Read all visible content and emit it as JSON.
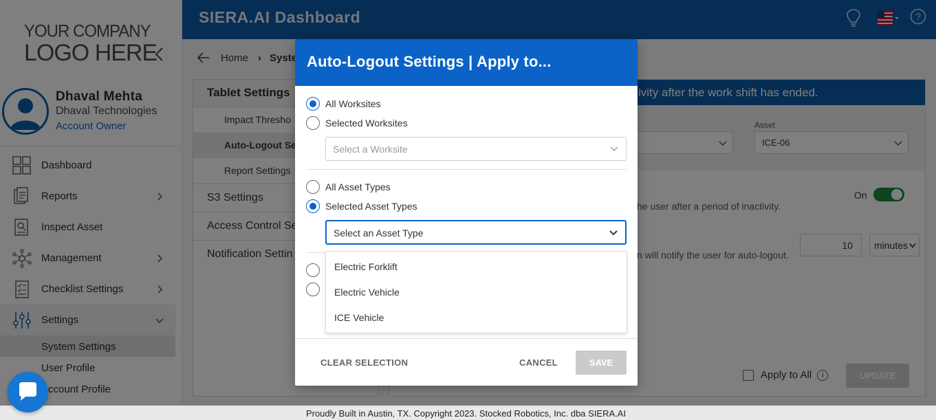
{
  "logo": {
    "line1": "YOUR COMPANY",
    "line2": "LOGO HERE"
  },
  "profile": {
    "name": "Dhaval Mehta",
    "company": "Dhaval Technologies",
    "role": "Account Owner"
  },
  "nav": {
    "items": [
      {
        "label": "Dashboard",
        "icon": "dashboard-grid-icon"
      },
      {
        "label": "Reports",
        "icon": "reports-icon"
      },
      {
        "label": "Inspect Asset",
        "icon": "inspect-asset-icon"
      },
      {
        "label": "Management",
        "icon": "management-network-icon"
      },
      {
        "label": "Checklist Settings",
        "icon": "checklist-icon"
      },
      {
        "label": "Settings",
        "icon": "settings-sliders-icon"
      }
    ],
    "settings_sub": [
      "System Settings",
      "User Profile",
      "Account Profile"
    ]
  },
  "topbar": {
    "brand": "SIERA.AI Dashboard"
  },
  "breadcrumb": {
    "home": "Home",
    "current": "Syste"
  },
  "settings_panel": {
    "header": "Tablet Settings",
    "subs": [
      "Impact Thresho",
      "Auto-Logout Se",
      "Report Settings"
    ],
    "sections": [
      "S3 Settings",
      "Access Control Se",
      "Notification Settin"
    ]
  },
  "content": {
    "banner": "ivity after the work shift has ended.",
    "asset_label": "Asset",
    "asset_value": "ICE-06",
    "toggle_label": "On",
    "desc1": "he user after a period of inactivity.",
    "desc2": "n will notify the user for auto-logout.",
    "minutes_value": "10",
    "unit": "minutes",
    "apply_all": "Apply to All",
    "info": "i",
    "update": "UPDATE"
  },
  "modal": {
    "title": "Auto-Logout Settings | Apply to...",
    "worksite_options": [
      "All Worksites",
      "Selected Worksites"
    ],
    "worksite_placeholder": "Select a Worksite",
    "asset_type_options": [
      "All Asset Types",
      "Selected Asset Types"
    ],
    "asset_type_placeholder": "Select an Asset Type",
    "dropdown_options": [
      "Electric Forklift",
      "Electric Vehicle",
      "ICE Vehicle"
    ],
    "clear": "CLEAR SELECTION",
    "cancel": "CANCEL",
    "save": "SAVE"
  },
  "footer": "Proudly Built in Austin, TX. Copyright 2023. Stocked Robotics, Inc. dba SIERA.AI",
  "colors": {
    "primary": "#0b63c7",
    "topbar": "#0d5aa8",
    "toggle_on": "#1e8a3a"
  }
}
